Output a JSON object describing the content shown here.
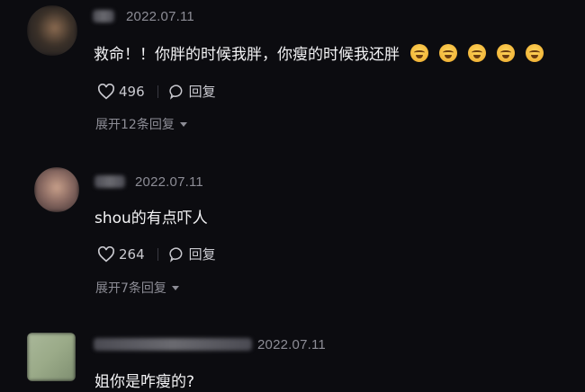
{
  "comments": [
    {
      "date": "2022.07.11",
      "text": "救命！！你胖的时候我胖，你瘦的时候我还胖",
      "emoji_icon": "grinning-sweat-face-icon",
      "emoji_count": 5,
      "likes": "496",
      "reply_label": "回复",
      "expand_label": "展开12条回复"
    },
    {
      "date": "2022.07.11",
      "text": "shou的有点吓人",
      "likes": "264",
      "reply_label": "回复",
      "expand_label": "展开7条回复"
    },
    {
      "date": "2022.07.11",
      "text": "姐你是咋瘦的?"
    }
  ],
  "colors": {
    "background": "#0c0c10",
    "text_primary": "#f3f3f5",
    "text_secondary": "#8d8d96"
  }
}
